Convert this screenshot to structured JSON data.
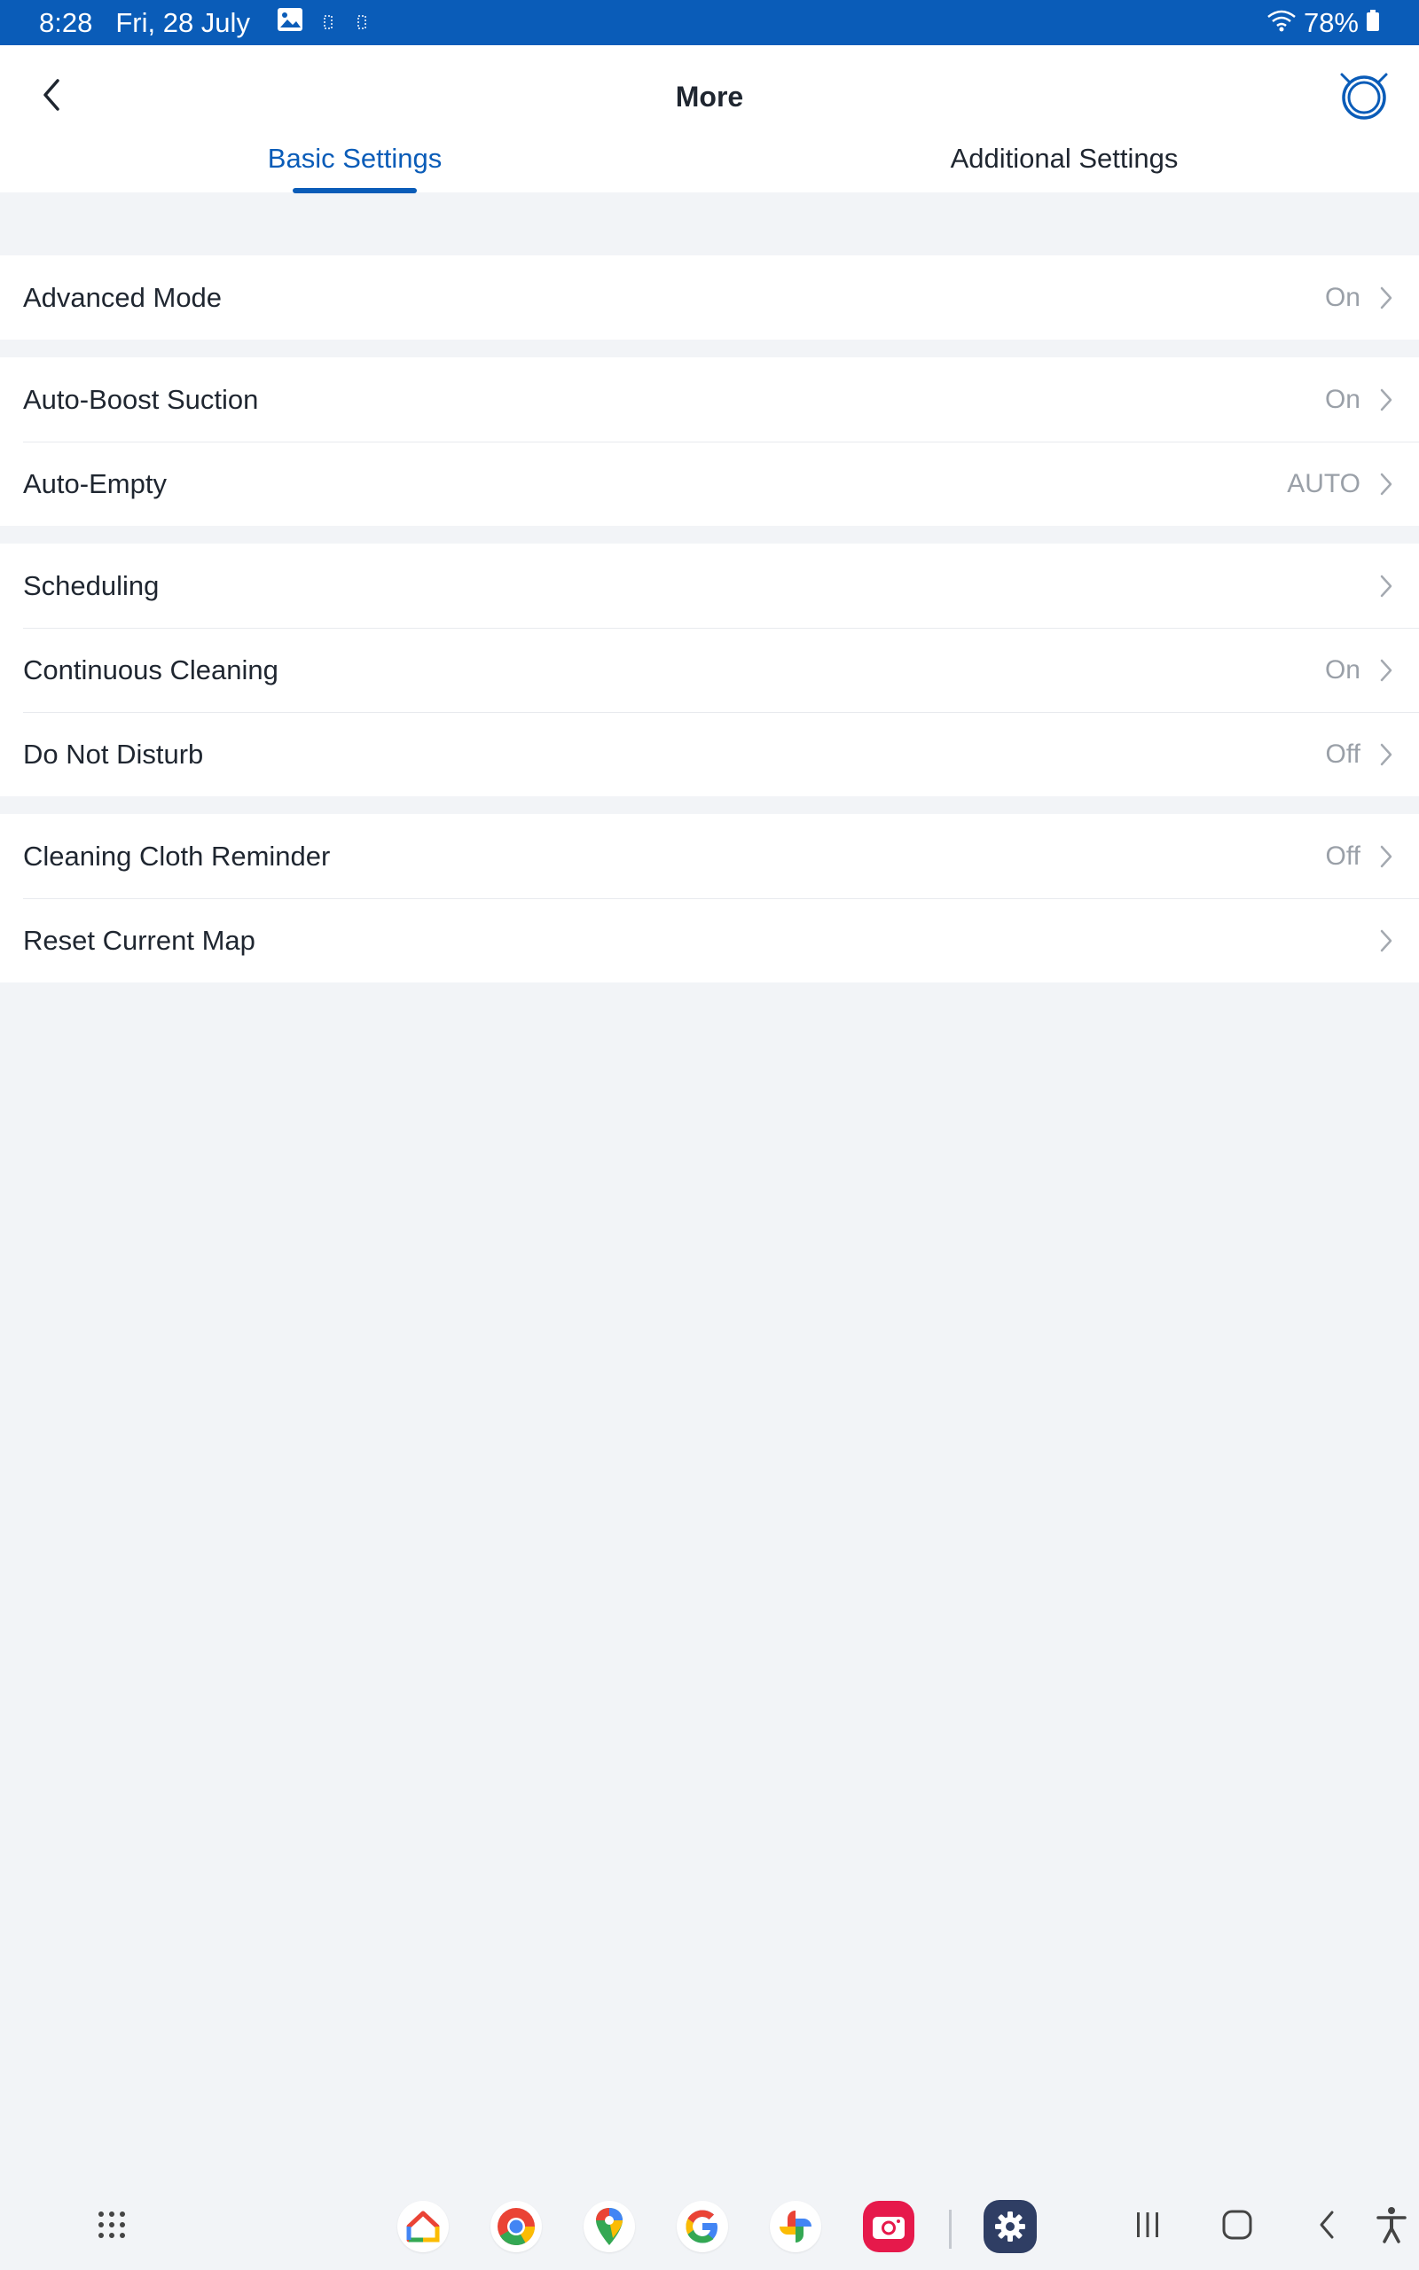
{
  "status_bar": {
    "time": "8:28",
    "date": "Fri, 28 July",
    "battery": "78%",
    "icons": [
      "gallery-icon",
      "sim-icon",
      "sim-icon",
      "wifi-icon",
      "battery-icon"
    ]
  },
  "header": {
    "title": "More",
    "back_icon": "chevron-left-icon",
    "robot_icon": "robot-vacuum-icon"
  },
  "tabs": [
    {
      "label": "Basic Settings",
      "active": true
    },
    {
      "label": "Additional Settings",
      "active": false
    }
  ],
  "groups": [
    {
      "items": [
        {
          "label": "Advanced Mode",
          "value": "On"
        }
      ]
    },
    {
      "items": [
        {
          "label": "Auto-Boost Suction",
          "value": "On"
        },
        {
          "label": "Auto-Empty",
          "value": "AUTO"
        }
      ]
    },
    {
      "items": [
        {
          "label": "Scheduling",
          "value": ""
        },
        {
          "label": "Continuous Cleaning",
          "value": "On"
        },
        {
          "label": "Do Not Disturb",
          "value": "Off"
        }
      ]
    },
    {
      "items": [
        {
          "label": "Cleaning Cloth Reminder",
          "value": "Off"
        },
        {
          "label": "Reset Current Map",
          "value": ""
        }
      ]
    }
  ],
  "navbar": {
    "apps": [
      "app-drawer-icon",
      "google-home-icon",
      "chrome-icon",
      "maps-icon",
      "google-icon",
      "photos-icon",
      "camera-icon",
      "settings-icon"
    ],
    "system": [
      "recents-icon",
      "home-icon",
      "back-icon",
      "accessibility-icon"
    ]
  },
  "colors": {
    "accent": "#0a5cb8",
    "background": "#f2f4f7",
    "text": "#1f2630",
    "value_text": "#9aa0a8"
  }
}
